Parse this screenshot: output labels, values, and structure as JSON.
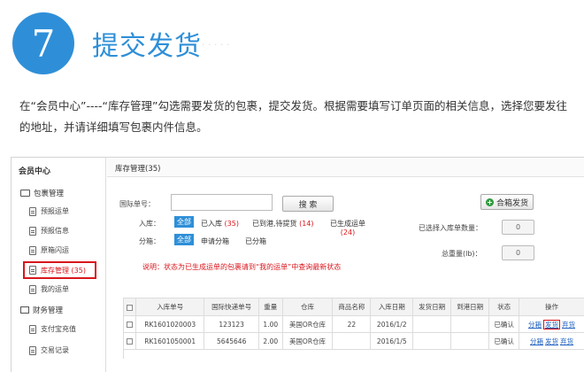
{
  "header": {
    "step_number": "7",
    "title": "提交发货",
    "ghost_text": "· · · · ·"
  },
  "description": "在“会员中心”----“库存管理”勾选需要发货的包裹，提交发货。根据需要填写订单页面的相关信息，选择您要发往的地址，并请详细填写包裹内件信息。",
  "sidebar": {
    "title": "会员中心",
    "groups": [
      {
        "label": "包裹管理",
        "items": [
          "预报运单",
          "预报信息",
          "原箱闪运",
          "库存管理 (35)",
          "我的运单"
        ]
      },
      {
        "label": "财务管理",
        "items": [
          "支付宝充值",
          "交易记录"
        ]
      }
    ]
  },
  "main": {
    "title": "库存管理(35)",
    "search_label": "国际单号：",
    "search_input": "",
    "search_button": "搜 索",
    "merge_button": "合箱发货",
    "warehouse_label": "入库：",
    "warehouse_options": [
      {
        "label": "全部",
        "count": ""
      },
      {
        "label": "已入库",
        "count": "(35)"
      },
      {
        "label": "已到港,待提货",
        "count": "(14)"
      },
      {
        "label": "已生成运单",
        "count": "(24)"
      }
    ],
    "split_label": "分箱：",
    "split_options": [
      "全部",
      "申请分箱",
      "已分箱"
    ],
    "note": "说明：状态为已生成运单的包裹请到“我的运单”中查询最新状态",
    "selected_count_label": "已选择入库单数量：",
    "selected_count_value": "0",
    "total_weight_label": "总重量(lb)：",
    "total_weight_value": "0"
  },
  "table": {
    "headers": [
      "",
      "入库单号",
      "国际快递单号",
      "重量",
      "仓库",
      "商品名称",
      "入库日期",
      "发货日期",
      "到港日期",
      "状态",
      "操作"
    ],
    "rows": [
      {
        "id": "RK1601020003",
        "tracking": "123123",
        "weight": "1.00",
        "warehouse": "美国OR仓库",
        "product": "22",
        "in_date": "2016/1/2",
        "ship_date": "",
        "arrive_date": "",
        "status": "已确认",
        "ops": [
          "分箱",
          "发货",
          "弃货"
        ]
      },
      {
        "id": "RK1601050001",
        "tracking": "5645646",
        "weight": "2.00",
        "warehouse": "美国OR仓库",
        "product": "",
        "in_date": "2016/1/5",
        "ship_date": "",
        "arrive_date": "",
        "status": "已确认",
        "ops": [
          "分箱",
          "发货",
          "弃货"
        ]
      }
    ]
  },
  "colors": {
    "accent": "#2e8fd8",
    "highlight": "#d9161c",
    "link": "#1f5fbf"
  }
}
